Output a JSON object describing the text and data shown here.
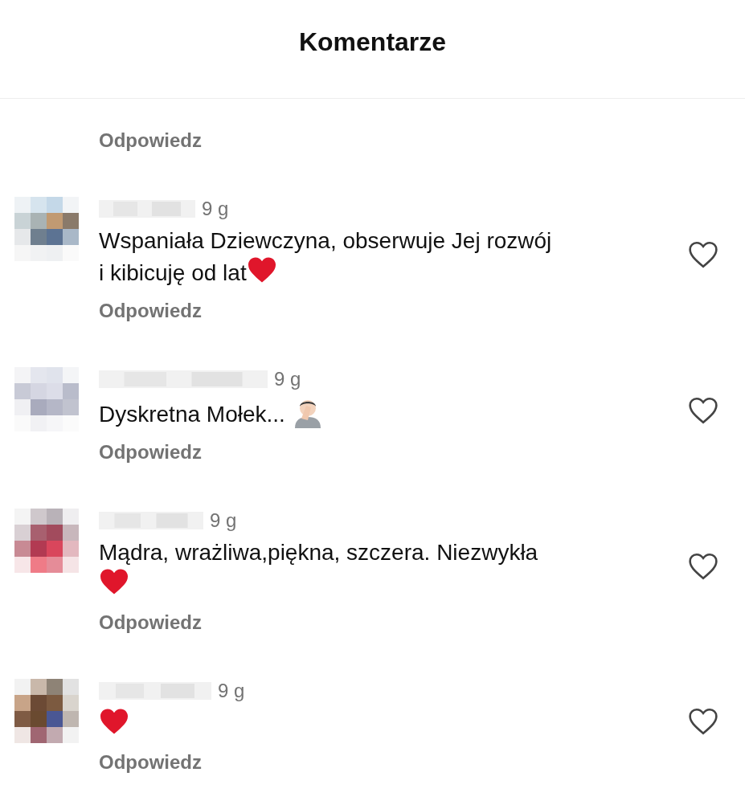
{
  "header": {
    "title": "Komentarze"
  },
  "partial_comment": {
    "reply": "Odpowiedz"
  },
  "comments": [
    {
      "time": "9 g",
      "lines": [
        [
          {
            "kind": "text",
            "text": "Wspaniała Dziewczyna, obserwuje Jej rozwój"
          }
        ],
        [
          {
            "kind": "text",
            "text": "i kibicuję od lat"
          },
          {
            "kind": "heart"
          }
        ]
      ],
      "reply": "Odpowiedz",
      "liked": false
    },
    {
      "time": "9 g",
      "lines": [
        [
          {
            "kind": "text",
            "text": "Dyskretna Mołek... "
          },
          {
            "kind": "facepalm"
          }
        ]
      ],
      "reply": "Odpowiedz",
      "liked": false
    },
    {
      "time": "9 g",
      "lines": [
        [
          {
            "kind": "text",
            "text": "Mądra, wrażliwa,piękna, szczera. Niezwykła"
          }
        ],
        [
          {
            "kind": "heart"
          }
        ]
      ],
      "reply": "Odpowiedz",
      "liked": false
    },
    {
      "time": "9 g",
      "lines": [
        [
          {
            "kind": "heart"
          }
        ]
      ],
      "reply": "Odpowiedz",
      "liked": false
    }
  ]
}
